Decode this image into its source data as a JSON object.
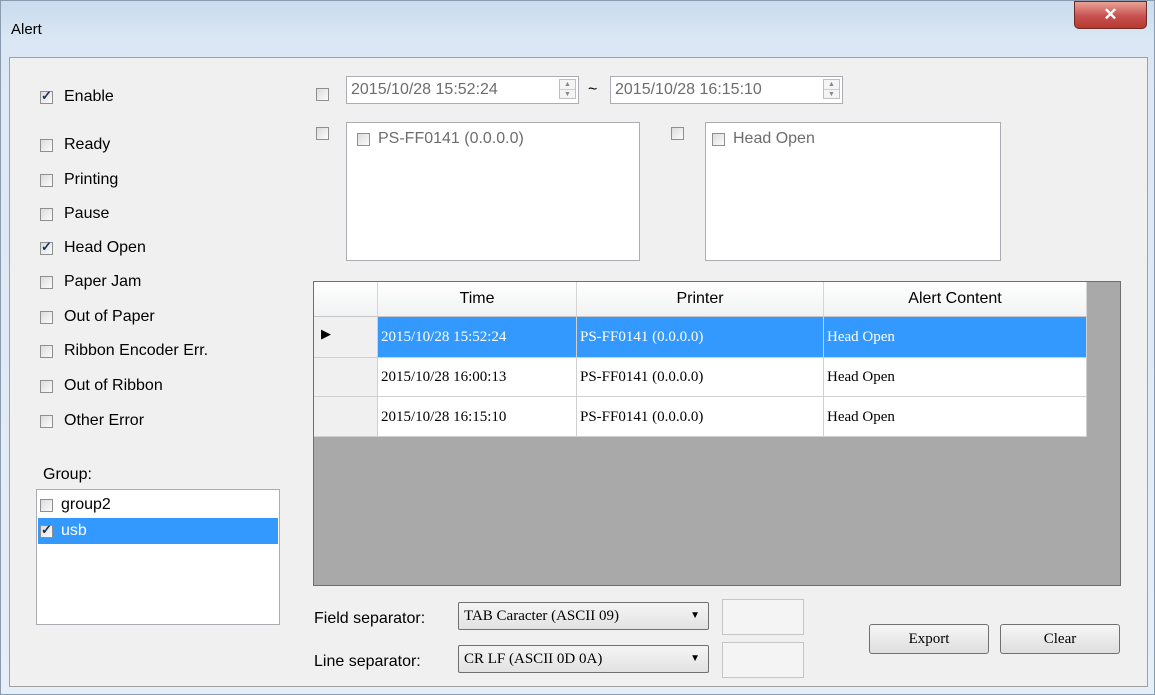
{
  "window": {
    "title": "Alert",
    "close_glyph": "✕"
  },
  "filters": {
    "enable": {
      "label": "Enable",
      "checked": true
    },
    "statuses": [
      {
        "label": "Ready",
        "checked": false
      },
      {
        "label": "Printing",
        "checked": false
      },
      {
        "label": "Pause",
        "checked": false
      },
      {
        "label": "Head Open",
        "checked": true
      },
      {
        "label": "Paper Jam",
        "checked": false
      },
      {
        "label": "Out of Paper",
        "checked": false
      },
      {
        "label": "Ribbon Encoder Err.",
        "checked": false
      },
      {
        "label": "Out of Ribbon",
        "checked": false
      },
      {
        "label": "Other Error",
        "checked": false
      }
    ],
    "group_label": "Group:",
    "groups": [
      {
        "label": "group2",
        "checked": false,
        "selected": false
      },
      {
        "label": "usb",
        "checked": true,
        "selected": true
      }
    ]
  },
  "date_range": {
    "start": "2015/10/28 15:52:24",
    "separator": "~",
    "end": "2015/10/28 16:15:10"
  },
  "printer_filter": {
    "items": [
      {
        "label": "PS-FF0141 (0.0.0.0)",
        "checked": false
      }
    ]
  },
  "alert_filter": {
    "items": [
      {
        "label": "Head Open",
        "checked": false
      }
    ]
  },
  "table": {
    "columns": [
      "Time",
      "Printer",
      "Alert Content"
    ],
    "rows": [
      [
        "2015/10/28 15:52:24",
        "PS-FF0141 (0.0.0.0)",
        "Head Open"
      ],
      [
        "2015/10/28 16:00:13",
        "PS-FF0141 (0.0.0.0)",
        "Head Open"
      ],
      [
        "2015/10/28 16:15:10",
        "PS-FF0141 (0.0.0.0)",
        "Head Open"
      ]
    ],
    "selected_row": 0
  },
  "export_settings": {
    "field_separator_label": "Field separator:",
    "field_separator_value": "TAB Caracter (ASCII 09)",
    "line_separator_label": "Line separator:",
    "line_separator_value": "CR LF (ASCII 0D 0A)"
  },
  "buttons": {
    "export": "Export",
    "clear": "Clear"
  },
  "colors": {
    "selection": "#3399ff",
    "grid_background": "#a9a9a9",
    "close_button": "#c75050"
  }
}
